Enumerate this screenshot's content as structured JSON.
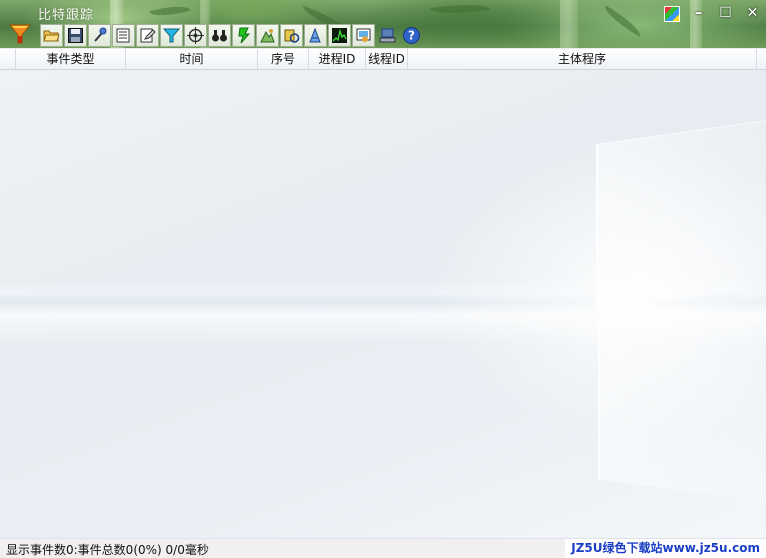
{
  "app": {
    "title": "比特跟踪"
  },
  "window_controls": {
    "skin": "skin-icon",
    "minimize": "–",
    "maximize": "☐",
    "close": "✕"
  },
  "toolbar": {
    "buttons": [
      {
        "name": "open-folder-icon"
      },
      {
        "name": "save-icon"
      },
      {
        "name": "magic-wand-icon"
      },
      {
        "name": "properties-list-icon"
      },
      {
        "name": "edit-filter-icon"
      },
      {
        "name": "filter-funnel-icon"
      },
      {
        "name": "target-capture-icon"
      },
      {
        "name": "binoculars-find-icon"
      },
      {
        "name": "highlight-icon"
      },
      {
        "name": "process-tree-icon"
      },
      {
        "name": "registry-activity-icon"
      },
      {
        "name": "file-activity-icon"
      },
      {
        "name": "profiling-chart-icon"
      },
      {
        "name": "network-activity-icon"
      },
      {
        "name": "computer-settings-icon"
      },
      {
        "name": "help-icon"
      }
    ]
  },
  "table": {
    "columns": [
      "事件类型",
      "时间",
      "序号",
      "进程ID",
      "线程ID",
      "主体程序"
    ],
    "rows": []
  },
  "statusbar": {
    "text": "显示事件数0:事件总数0(0%) 0/0毫秒",
    "watermark": "JZ5U绿色下载站www.jz5u.com"
  },
  "colors": {
    "accent": "#1a3fc4",
    "title_text": "#f2f7ee"
  }
}
